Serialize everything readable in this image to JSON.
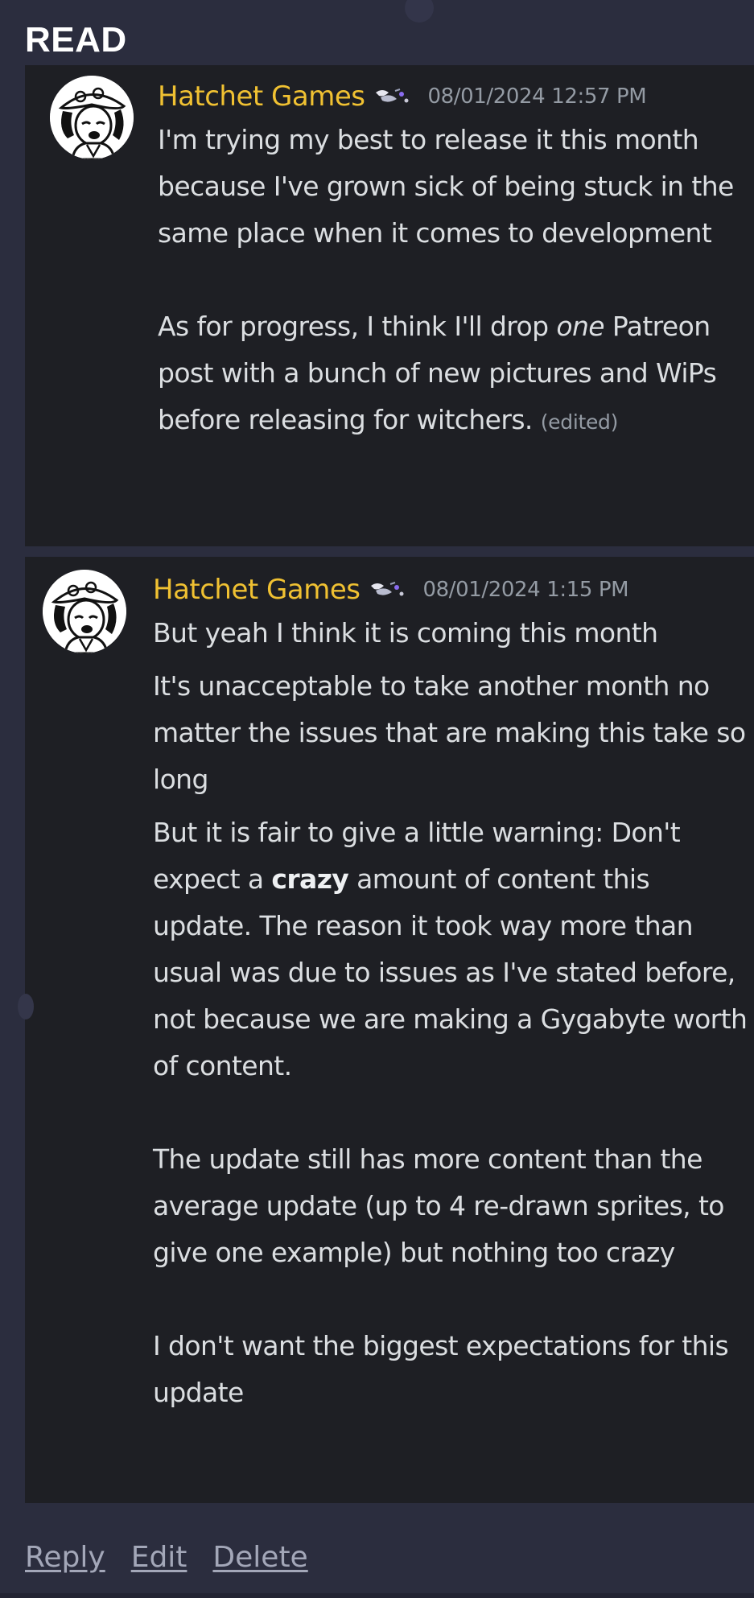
{
  "section_label": "READ",
  "messages": [
    {
      "author": "Hatchet Games",
      "timestamp": "08/01/2024 12:57 PM",
      "paragraphs": {
        "p1": "I'm trying my best to release it this month because I've grown sick of being stuck in the same place when it comes to development",
        "p2_before": "As for progress, I think I'll drop ",
        "p2_emphasis": "one",
        "p2_after": " Patreon post with a bunch of new pictures and WiPs before releasing for witchers.",
        "edited_label": "(edited)"
      }
    },
    {
      "author": "Hatchet Games",
      "timestamp": "08/01/2024 1:15 PM",
      "paragraphs": {
        "l1": "But yeah I think it is coming this month",
        "l2": "It's unacceptable to take another month no matter the issues that are making this take so long",
        "l3_before": "But it is fair to give a little warning: Don't expect a ",
        "l3_bold": "crazy",
        "l3_after": " amount of content this update. The reason it took way more than usual was due to issues as I've stated before, not because we are making a Gygabyte worth of content.",
        "l4": "The update still has more content than the average update (up to 4 re-drawn sprites, to give one example) but nothing too crazy",
        "l5": "I don't want the biggest expectations for this update"
      }
    }
  ],
  "actions": {
    "reply": "Reply",
    "edit": "Edit",
    "delete": "Delete"
  },
  "icons": {
    "avatar": "hatchet-games-avatar",
    "role": "role-badge-icon"
  },
  "colors": {
    "background": "#2b2d3e",
    "card": "#1e1f24",
    "author": "#f0c132",
    "text": "#dbdee1",
    "muted": "#949ba4"
  }
}
